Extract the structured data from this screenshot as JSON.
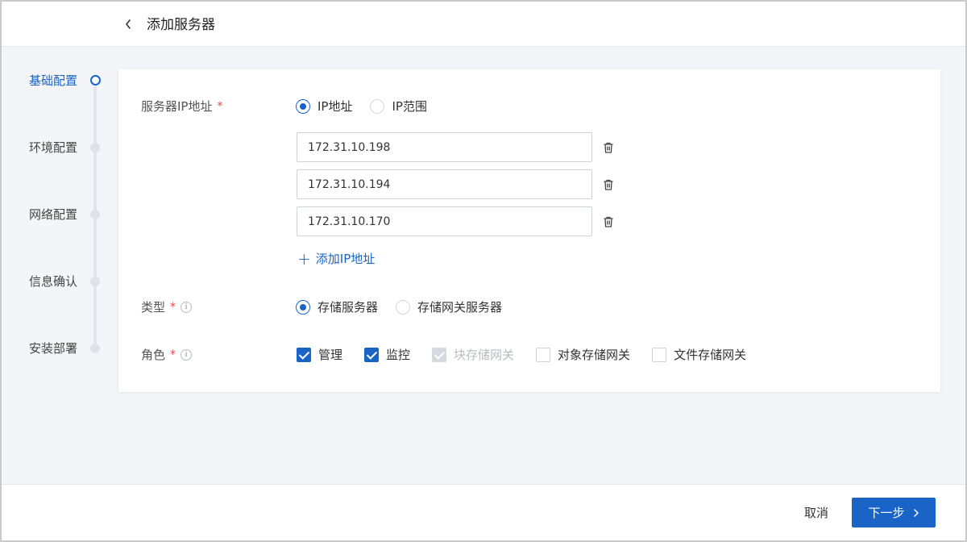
{
  "header": {
    "title": "添加服务器",
    "back_icon": "chevron-left-icon"
  },
  "steps": [
    {
      "label": "基础配置",
      "state": "active"
    },
    {
      "label": "环境配置",
      "state": "pending"
    },
    {
      "label": "网络配置",
      "state": "pending"
    },
    {
      "label": "信息确认",
      "state": "pending"
    },
    {
      "label": "安装部署",
      "state": "pending"
    }
  ],
  "form": {
    "server_ip": {
      "label": "服务器IP地址",
      "required_mark": "*",
      "mode_options": [
        {
          "label": "IP地址",
          "checked": true
        },
        {
          "label": "IP范围",
          "checked": false
        }
      ],
      "addresses": [
        "172.31.10.198",
        "172.31.10.194",
        "172.31.10.170"
      ],
      "add_label": "添加IP地址",
      "add_icon": "plus-icon",
      "delete_icon": "trash-icon"
    },
    "type": {
      "label": "类型",
      "required_mark": "*",
      "info_icon": "info-icon",
      "options": [
        {
          "label": "存储服务器",
          "checked": true
        },
        {
          "label": "存储网关服务器",
          "checked": false
        }
      ]
    },
    "role": {
      "label": "角色",
      "required_mark": "*",
      "info_icon": "info-icon",
      "options": [
        {
          "label": "管理",
          "checked": true,
          "disabled": false
        },
        {
          "label": "监控",
          "checked": true,
          "disabled": false
        },
        {
          "label": "块存储网关",
          "checked": true,
          "disabled": true
        },
        {
          "label": "对象存储网关",
          "checked": false,
          "disabled": false
        },
        {
          "label": "文件存储网关",
          "checked": false,
          "disabled": false
        }
      ]
    }
  },
  "footer": {
    "cancel_label": "取消",
    "next_label": "下一步",
    "next_icon": "chevron-right-icon"
  },
  "colors": {
    "primary": "#1a64c8",
    "required": "#e5484d",
    "background": "#f3f5f8"
  }
}
